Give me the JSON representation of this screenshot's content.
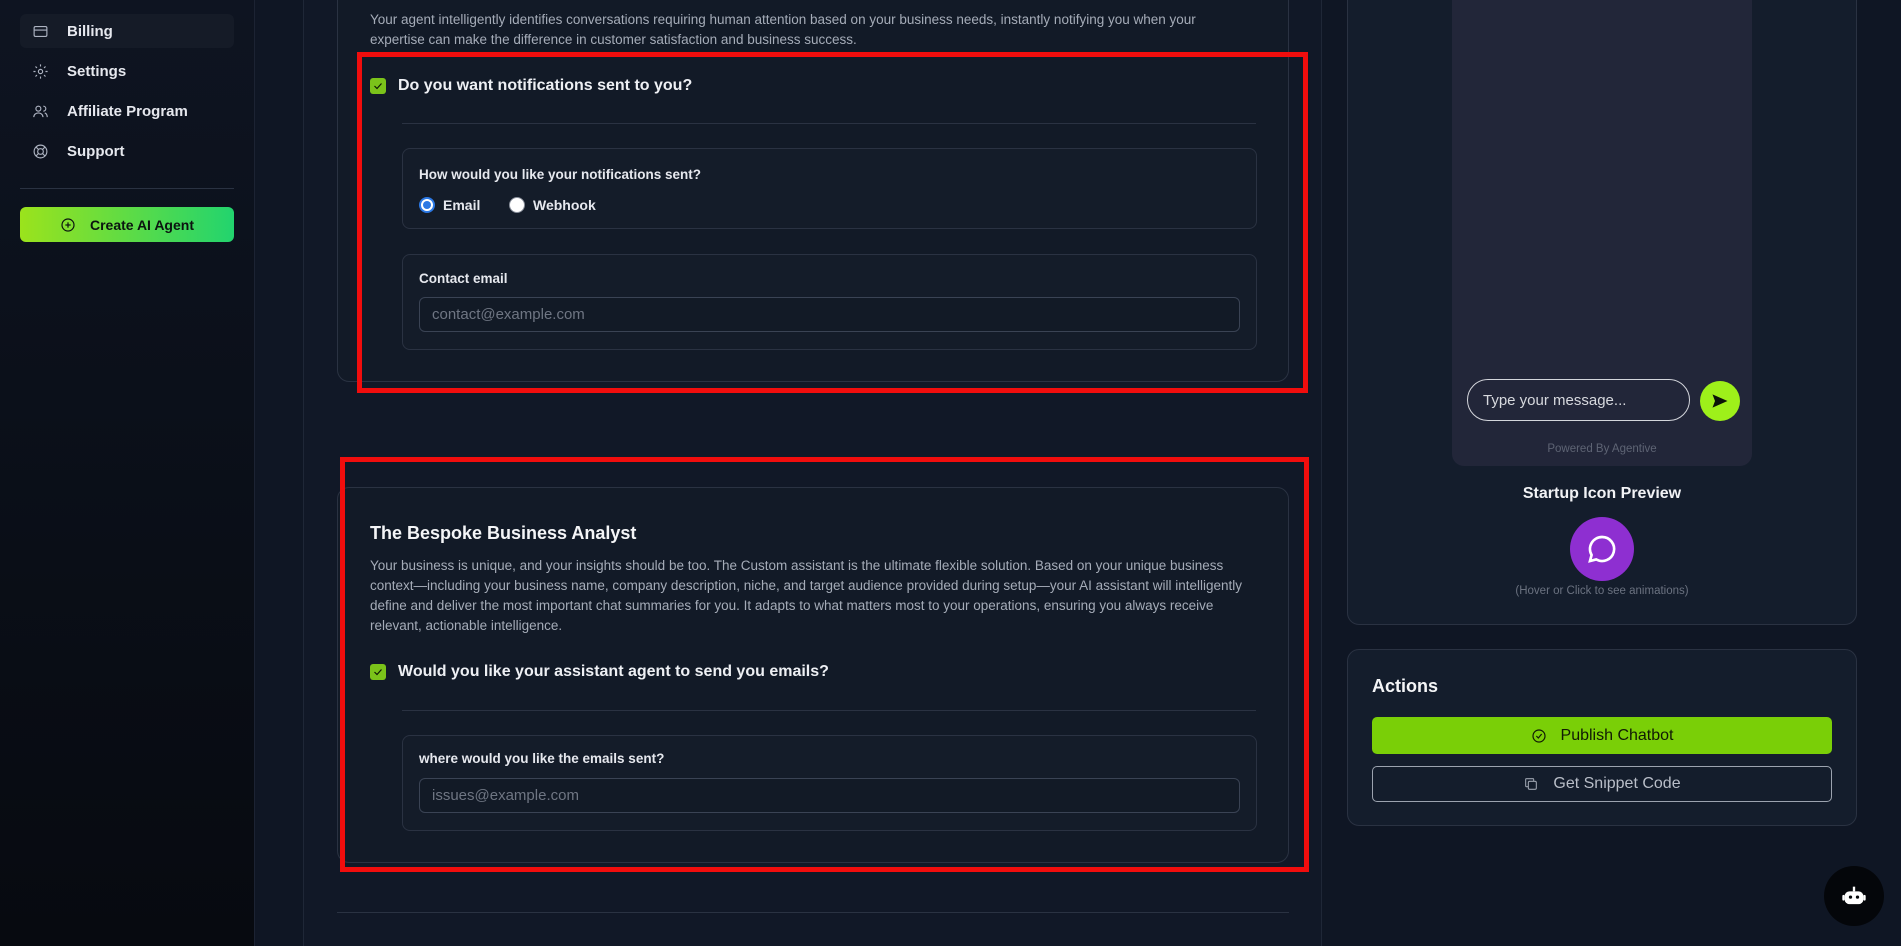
{
  "sidebar": {
    "items": [
      {
        "label": "Billing",
        "icon": "credit-card-icon"
      },
      {
        "label": "Settings",
        "icon": "gear-icon"
      },
      {
        "label": "Affiliate Program",
        "icon": "users-icon"
      },
      {
        "label": "Support",
        "icon": "lifebuoy-icon"
      }
    ],
    "create_label": "Create AI Agent"
  },
  "notifications": {
    "intro": "Your agent intelligently identifies conversations requiring human attention based on your business needs, instantly notifying you when your expertise can make the difference in customer satisfaction and business success.",
    "checkbox_label": "Do you want notifications sent to you?",
    "checked": true,
    "method_question": "How would you like your notifications sent?",
    "methods": [
      {
        "label": "Email",
        "selected": true
      },
      {
        "label": "Webhook",
        "selected": false
      }
    ],
    "contact_label": "Contact email",
    "contact_placeholder": "contact@example.com"
  },
  "analyst": {
    "title": "The Bespoke Business Analyst",
    "description": "Your business is unique, and your insights should be too. The Custom assistant is the ultimate flexible solution. Based on your unique business context—including your business name, company description, niche, and target audience provided during setup—your AI assistant will intelligently define and deliver the most important chat summaries for you. It adapts to what matters most to your operations, ensuring you always receive relevant, actionable intelligence.",
    "checkbox_label": "Would you like your assistant agent to send you emails?",
    "checked": true,
    "email_label": "where would you like the emails sent?",
    "email_placeholder": "issues@example.com"
  },
  "preview": {
    "message_placeholder": "Type your message...",
    "powered_by": "Powered By Agentive",
    "startup_title": "Startup Icon Preview",
    "hover_hint": "(Hover or Click to see animations)"
  },
  "actions": {
    "title": "Actions",
    "publish_label": "Publish Chatbot",
    "snippet_label": "Get Snippet Code"
  },
  "colors": {
    "accent": "#7acf07",
    "highlight": "#f10d0d",
    "startup_icon": "#8e2fd1"
  }
}
